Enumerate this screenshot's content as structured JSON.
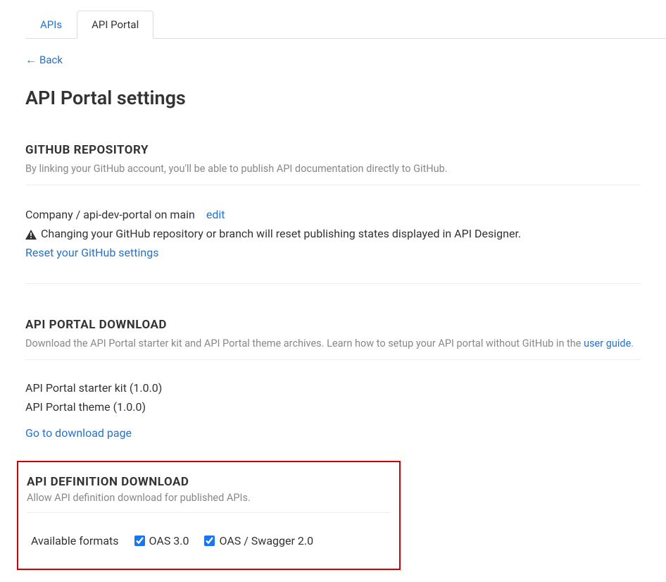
{
  "tabs": {
    "apis": "APIs",
    "portal": "API Portal"
  },
  "back": "Back",
  "page_title": "API Portal settings",
  "github": {
    "title": "GITHUB REPOSITORY",
    "desc": "By linking your GitHub account, you'll be able to publish API documentation directly to GitHub.",
    "repo_text": "Company / api-dev-portal on main",
    "edit": "edit",
    "warning": "Changing your GitHub repository or branch will reset publishing states displayed in API Designer.",
    "reset": "Reset your GitHub settings"
  },
  "download": {
    "title": "API PORTAL DOWNLOAD",
    "desc_prefix": "Download the API Portal starter kit and API Portal theme archives. Learn how to setup your API portal without GitHub in the ",
    "desc_link": "user guide",
    "desc_suffix": ".",
    "starter": "API Portal starter kit (1.0.0)",
    "theme": "API Portal theme (1.0.0)",
    "go": "Go to download page"
  },
  "definition": {
    "title": "API DEFINITION DOWNLOAD",
    "desc": "Allow API definition download for published APIs.",
    "formats_label": "Available formats",
    "oas3": "OAS 3.0",
    "swagger2": "OAS / Swagger 2.0"
  }
}
